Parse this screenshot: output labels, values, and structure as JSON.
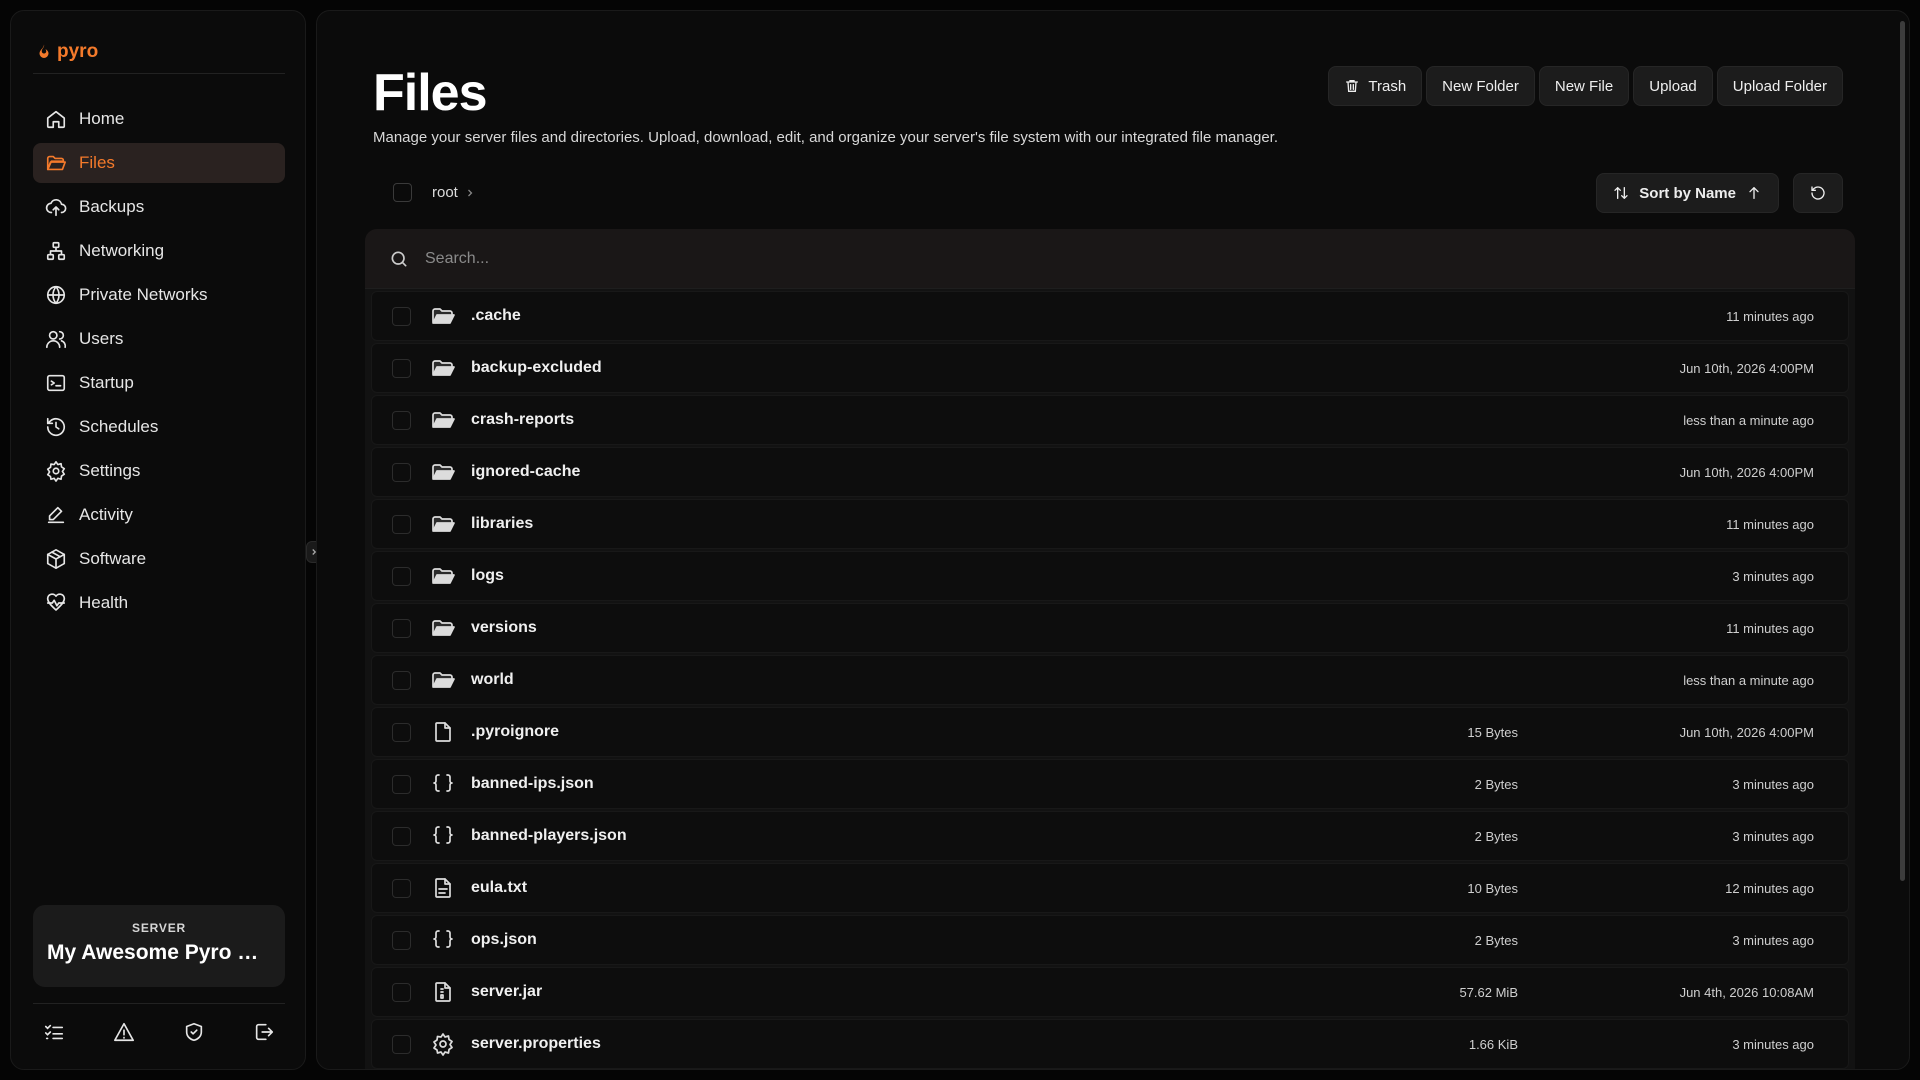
{
  "app": {
    "logo": "pyro",
    "accent": "#f47a2b"
  },
  "sidebar": {
    "items": [
      {
        "label": "Home",
        "icon": "home-icon"
      },
      {
        "label": "Files",
        "icon": "folder-open-icon",
        "active": true
      },
      {
        "label": "Backups",
        "icon": "cloud-upload-icon"
      },
      {
        "label": "Networking",
        "icon": "network-icon"
      },
      {
        "label": "Private Networks",
        "icon": "globe-icon"
      },
      {
        "label": "Users",
        "icon": "users-icon"
      },
      {
        "label": "Startup",
        "icon": "terminal-icon"
      },
      {
        "label": "Schedules",
        "icon": "clock-icon"
      },
      {
        "label": "Settings",
        "icon": "gear-icon"
      },
      {
        "label": "Activity",
        "icon": "pen-icon"
      },
      {
        "label": "Software",
        "icon": "package-icon"
      },
      {
        "label": "Health",
        "icon": "heart-pulse-icon"
      }
    ],
    "server": {
      "label": "SERVER",
      "name": "My Awesome Pyro Se..."
    },
    "bottom_icons": [
      "list-checks-icon",
      "warning-icon",
      "shield-icon",
      "logout-icon"
    ]
  },
  "header": {
    "title": "Files",
    "subtitle": "Manage your server files and directories. Upload, download, edit, and organize your server's file system with our integrated file manager.",
    "actions": [
      "Trash",
      "New Folder",
      "New File",
      "Upload",
      "Upload Folder"
    ]
  },
  "toolbar": {
    "breadcrumb": "root",
    "sort_label": "Sort by Name"
  },
  "search": {
    "placeholder": "Search..."
  },
  "files": [
    {
      "name": ".cache",
      "type": "folder",
      "size": "",
      "modified": "11 minutes ago"
    },
    {
      "name": "backup-excluded",
      "type": "folder",
      "size": "",
      "modified": "Jun 10th, 2026 4:00PM"
    },
    {
      "name": "crash-reports",
      "type": "folder",
      "size": "",
      "modified": "less than a minute ago"
    },
    {
      "name": "ignored-cache",
      "type": "folder",
      "size": "",
      "modified": "Jun 10th, 2026 4:00PM"
    },
    {
      "name": "libraries",
      "type": "folder",
      "size": "",
      "modified": "11 minutes ago"
    },
    {
      "name": "logs",
      "type": "folder",
      "size": "",
      "modified": "3 minutes ago"
    },
    {
      "name": "versions",
      "type": "folder",
      "size": "",
      "modified": "11 minutes ago"
    },
    {
      "name": "world",
      "type": "folder",
      "size": "",
      "modified": "less than a minute ago"
    },
    {
      "name": ".pyroignore",
      "type": "file",
      "size": "15 Bytes",
      "modified": "Jun 10th, 2026 4:00PM"
    },
    {
      "name": "banned-ips.json",
      "type": "json",
      "size": "2 Bytes",
      "modified": "3 minutes ago"
    },
    {
      "name": "banned-players.json",
      "type": "json",
      "size": "2 Bytes",
      "modified": "3 minutes ago"
    },
    {
      "name": "eula.txt",
      "type": "text",
      "size": "10 Bytes",
      "modified": "12 minutes ago"
    },
    {
      "name": "ops.json",
      "type": "json",
      "size": "2 Bytes",
      "modified": "3 minutes ago"
    },
    {
      "name": "server.jar",
      "type": "archive",
      "size": "57.62 MiB",
      "modified": "Jun 4th, 2026 10:08AM"
    },
    {
      "name": "server.properties",
      "type": "config",
      "size": "1.66 KiB",
      "modified": "3 minutes ago"
    }
  ]
}
